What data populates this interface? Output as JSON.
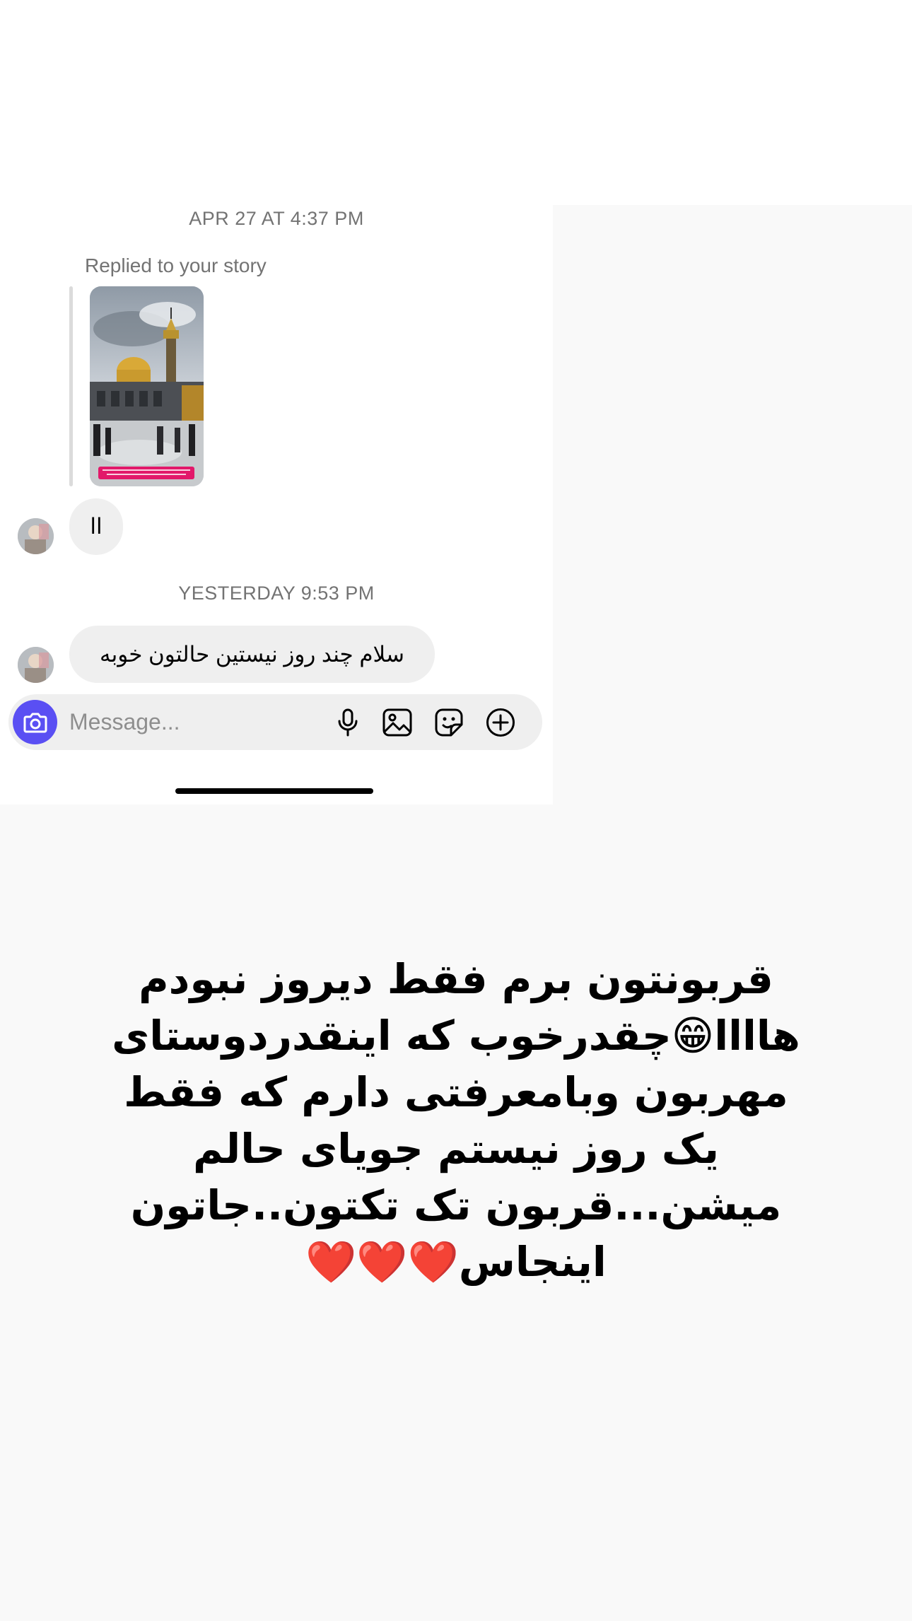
{
  "chat": {
    "timestamp_1": "APR 27 AT 4:37 PM",
    "reply_label": "Replied to your story",
    "message_1": "اا",
    "timestamp_2": "YESTERDAY 9:53 PM",
    "message_2": "سلام چند روز نیستین حالتون خوبه"
  },
  "composer": {
    "placeholder": "Message...",
    "icons": [
      "camera-icon",
      "microphone-icon",
      "gallery-icon",
      "sticker-icon",
      "plus-circle-icon"
    ],
    "accent_color": "#5a4ff3"
  },
  "story": {
    "text": "قربونتون برم فقط دیروز نبودم هاااا😁چقدرخوب که اینقدردوستای مهربون وبامعرفتی دارم که فقط یک روز نیستم جویای حالم میشن...قربون تک تکتون..جاتون اینجاس❤️❤️❤️"
  }
}
